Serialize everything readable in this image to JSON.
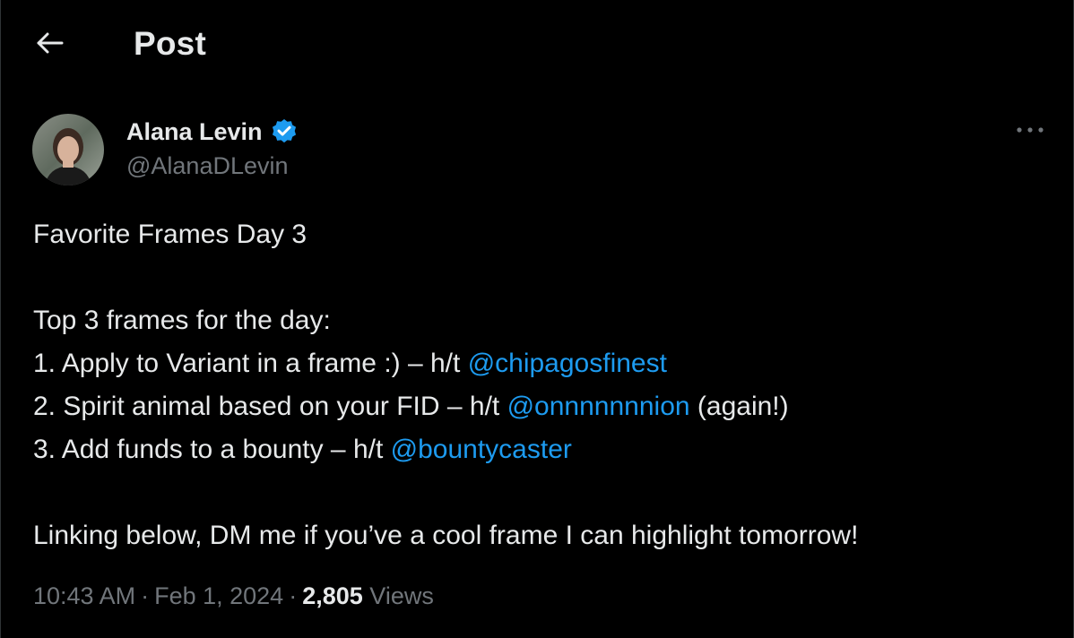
{
  "header": {
    "title": "Post"
  },
  "author": {
    "name": "Alana Levin",
    "handle": "@AlanaDLevin",
    "verified": true
  },
  "tweet": {
    "line1": "Favorite Frames Day 3",
    "line2": "Top 3 frames for the day:",
    "item1_text": "1. Apply to Variant in a frame :)  – h/t ",
    "item1_mention": "@chipagosfinest",
    "item2_text": "2. Spirit animal based on your FID – h/t ",
    "item2_mention": "@onnnnnnnion",
    "item2_suffix": " (again!)",
    "item3_text": "3. Add funds to a bounty – h/t ",
    "item3_mention": "@bountycaster",
    "line_final": "Linking below, DM me if you’ve a cool frame I can highlight tomorrow!"
  },
  "meta": {
    "time": "10:43 AM",
    "date": "Feb 1, 2024",
    "separator": "·",
    "views_count": "2,805",
    "views_label": "Views"
  },
  "colors": {
    "background": "#000000",
    "text": "#e7e9ea",
    "secondary": "#71767b",
    "link": "#1d9bf0",
    "verified": "#1d9bf0"
  },
  "icons": {
    "back": "arrow-left-icon",
    "verified": "verified-badge-icon",
    "more": "more-horizontal-icon"
  }
}
